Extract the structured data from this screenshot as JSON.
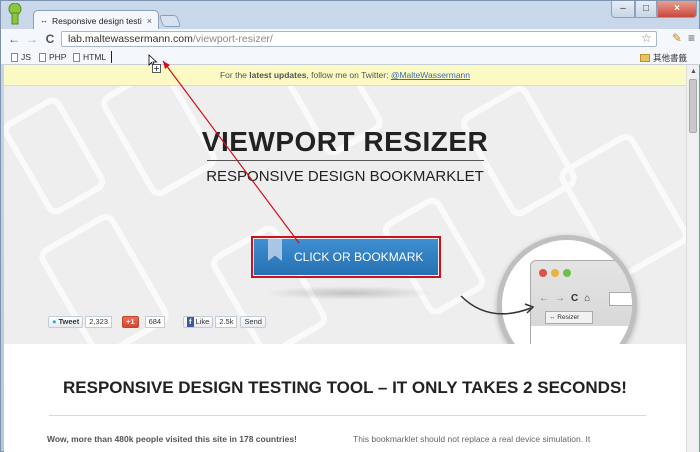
{
  "browser": {
    "tab": {
      "favicon": "↔",
      "title": "Responsive design testi",
      "close": "×"
    },
    "window_controls": {
      "minimize": "–",
      "maximize": "□",
      "close": "×"
    },
    "url": {
      "host": "lab.maltewassermann.com",
      "path": "/viewport-resizer/"
    },
    "nav": {
      "back": "←",
      "forward": "→",
      "reload": "C"
    },
    "tool_icons": {
      "star": "☆",
      "note": "✎",
      "menu": "≡"
    },
    "bookmarks": [
      "JS",
      "PHP",
      "HTML"
    ],
    "other_bookmarks": "其他書籤"
  },
  "page": {
    "notice": {
      "prefix": "For the ",
      "bold": "latest updates",
      "middle": ", follow me on Twitter: ",
      "link": "@MalteWassermann"
    },
    "hero": {
      "title": "VIEWPORT RESIZER",
      "subtitle": "RESPONSIVE DESIGN BOOKMARKLET",
      "cta_label": "CLICK OR BOOKMARK"
    },
    "social": {
      "tweet": "Tweet",
      "tweet_count": "2,323",
      "gplus": "+1",
      "gplus_count": "684",
      "like": "Like",
      "like_count": "2.5k",
      "send": "Send"
    },
    "magnifier": {
      "tab_label": "↔ Resizer",
      "lights": [
        "#e0504a",
        "#e8b43a",
        "#6cbf4a"
      ],
      "back": "←",
      "forward": "→",
      "reload": "C",
      "home": "⌂"
    },
    "section_title": "RESPONSIVE DESIGN TESTING TOOL – IT ONLY TAKES 2 SECONDS!",
    "para_left": "Wow, more than 480k people visited this site in 178 countries!",
    "para_right": "This bookmarklet should not replace a real device simulation. It"
  },
  "colors": {
    "accent_blue": "#2f7fc4",
    "annotation_red": "#d0101c",
    "notice_bg": "#fbf9c4"
  }
}
